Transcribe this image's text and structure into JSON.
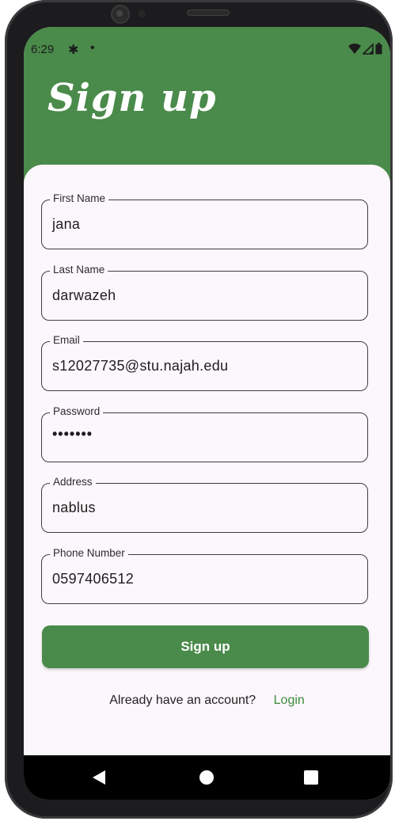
{
  "status_bar": {
    "time": "6:29",
    "gear_icon": "gear-icon",
    "dot": "•"
  },
  "header": {
    "title": "Sign up"
  },
  "form": {
    "fields": [
      {
        "label": "First Name",
        "value": "jana"
      },
      {
        "label": "Last Name",
        "value": "darwazeh"
      },
      {
        "label": "Email",
        "value": "s12027735@stu.najah.edu"
      },
      {
        "label": "Password",
        "value": "•••••••"
      },
      {
        "label": "Address",
        "value": "nablus"
      },
      {
        "label": "Phone Number",
        "value": "0597406512"
      }
    ],
    "submit_label": "Sign up",
    "login_prompt": "Already have an account?",
    "login_link": "Login"
  },
  "colors": {
    "primary": "#4a8a4a",
    "background": "#fcf7fc"
  }
}
